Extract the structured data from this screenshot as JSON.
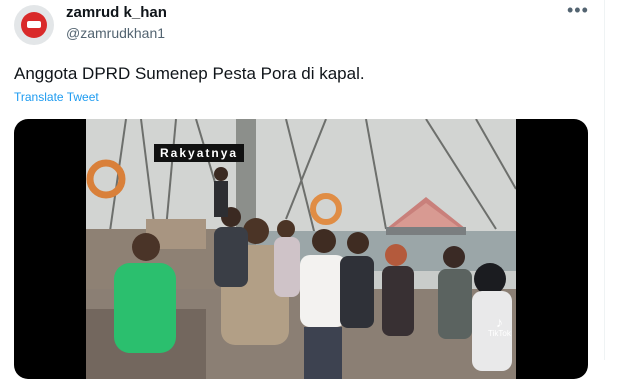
{
  "tweet": {
    "display_name": "zamrud k_han",
    "handle": "@zamrudkhan1",
    "text": "Anggota DPRD Sumenep Pesta Pora di kapal.",
    "translate_label": "Translate Tweet",
    "more_icon": "more-horizontal-icon"
  },
  "media": {
    "caption": "Rakyatnya",
    "watermark": "TikTok"
  }
}
